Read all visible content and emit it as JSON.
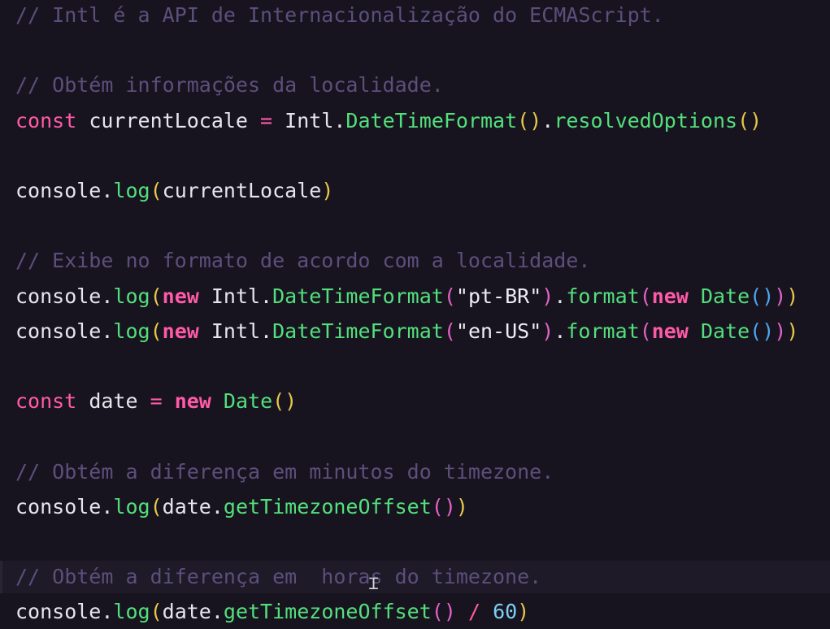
{
  "editor": {
    "cursor_icon": "text-cursor-icon",
    "colors": {
      "background": "#18141f",
      "comment": "#5b4f7c",
      "keyword": "#ff5aa8",
      "function": "#52e07c",
      "text": "#e7e5ec",
      "string": "#f0ecf4",
      "number": "#7ecff5",
      "paren_yellow": "#e6c94a",
      "paren_pink": "#e063c6",
      "paren_blue": "#4aa7f0",
      "operator": "#ff5aa8"
    },
    "lines": [
      {
        "tokens": [
          {
            "t": "// Intl é a API de Internacionalização do ECMAScript.",
            "k": "comment"
          }
        ]
      },
      {
        "tokens": []
      },
      {
        "tokens": [
          {
            "t": "// Obtém informações da localidade.",
            "k": "comment"
          }
        ]
      },
      {
        "tokens": [
          {
            "t": "const",
            "k": "keyword"
          },
          {
            "t": " currentLocale ",
            "k": "text"
          },
          {
            "t": "=",
            "k": "operator"
          },
          {
            "t": " Intl.",
            "k": "text"
          },
          {
            "t": "DateTimeFormat",
            "k": "function"
          },
          {
            "t": "()",
            "k": "paren_yellow"
          },
          {
            "t": ".",
            "k": "text"
          },
          {
            "t": "resolvedOptions",
            "k": "function"
          },
          {
            "t": "()",
            "k": "paren_yellow"
          }
        ]
      },
      {
        "tokens": []
      },
      {
        "tokens": [
          {
            "t": "console.",
            "k": "text"
          },
          {
            "t": "log",
            "k": "function"
          },
          {
            "t": "(",
            "k": "paren_yellow"
          },
          {
            "t": "currentLocale",
            "k": "text"
          },
          {
            "t": ")",
            "k": "paren_yellow"
          }
        ]
      },
      {
        "tokens": []
      },
      {
        "tokens": [
          {
            "t": "// Exibe no formato de acordo com a localidade.",
            "k": "comment"
          }
        ]
      },
      {
        "tokens": [
          {
            "t": "console.",
            "k": "text"
          },
          {
            "t": "log",
            "k": "function"
          },
          {
            "t": "(",
            "k": "paren_yellow"
          },
          {
            "t": "new",
            "k": "keyword_bold"
          },
          {
            "t": " Intl.",
            "k": "text"
          },
          {
            "t": "DateTimeFormat",
            "k": "function"
          },
          {
            "t": "(",
            "k": "paren_pink"
          },
          {
            "t": "\"pt-BR\"",
            "k": "string"
          },
          {
            "t": ")",
            "k": "paren_pink"
          },
          {
            "t": ".",
            "k": "text"
          },
          {
            "t": "format",
            "k": "function"
          },
          {
            "t": "(",
            "k": "paren_pink"
          },
          {
            "t": "new",
            "k": "keyword_bold"
          },
          {
            "t": " Date",
            "k": "function"
          },
          {
            "t": "()",
            "k": "paren_blue"
          },
          {
            "t": ")",
            "k": "paren_pink"
          },
          {
            "t": ")",
            "k": "paren_yellow"
          }
        ]
      },
      {
        "tokens": [
          {
            "t": "console.",
            "k": "text"
          },
          {
            "t": "log",
            "k": "function"
          },
          {
            "t": "(",
            "k": "paren_yellow"
          },
          {
            "t": "new",
            "k": "keyword_bold"
          },
          {
            "t": " Intl.",
            "k": "text"
          },
          {
            "t": "DateTimeFormat",
            "k": "function"
          },
          {
            "t": "(",
            "k": "paren_pink"
          },
          {
            "t": "\"en-US\"",
            "k": "string"
          },
          {
            "t": ")",
            "k": "paren_pink"
          },
          {
            "t": ".",
            "k": "text"
          },
          {
            "t": "format",
            "k": "function"
          },
          {
            "t": "(",
            "k": "paren_pink"
          },
          {
            "t": "new",
            "k": "keyword_bold"
          },
          {
            "t": " Date",
            "k": "function"
          },
          {
            "t": "()",
            "k": "paren_blue"
          },
          {
            "t": ")",
            "k": "paren_pink"
          },
          {
            "t": ")",
            "k": "paren_yellow"
          }
        ]
      },
      {
        "tokens": []
      },
      {
        "tokens": [
          {
            "t": "const",
            "k": "keyword"
          },
          {
            "t": " date ",
            "k": "text"
          },
          {
            "t": "=",
            "k": "operator"
          },
          {
            "t": " ",
            "k": "text"
          },
          {
            "t": "new",
            "k": "keyword_bold"
          },
          {
            "t": " Date",
            "k": "function"
          },
          {
            "t": "()",
            "k": "paren_yellow"
          }
        ]
      },
      {
        "tokens": []
      },
      {
        "tokens": [
          {
            "t": "// Obtém a diferença em minutos do timezone.",
            "k": "comment"
          }
        ]
      },
      {
        "tokens": [
          {
            "t": "console.",
            "k": "text"
          },
          {
            "t": "log",
            "k": "function"
          },
          {
            "t": "(",
            "k": "paren_yellow"
          },
          {
            "t": "date.",
            "k": "text"
          },
          {
            "t": "getTimezoneOffset",
            "k": "function"
          },
          {
            "t": "()",
            "k": "paren_pink"
          },
          {
            "t": ")",
            "k": "paren_yellow"
          }
        ]
      },
      {
        "tokens": []
      },
      {
        "tokens": [
          {
            "t": "// Obtém a diferença em  horas do timezone.",
            "k": "comment"
          }
        ]
      },
      {
        "tokens": [
          {
            "t": "console.",
            "k": "text"
          },
          {
            "t": "log",
            "k": "function"
          },
          {
            "t": "(",
            "k": "paren_yellow"
          },
          {
            "t": "date.",
            "k": "text"
          },
          {
            "t": "getTimezoneOffset",
            "k": "function"
          },
          {
            "t": "()",
            "k": "paren_pink"
          },
          {
            "t": " ",
            "k": "text"
          },
          {
            "t": "/",
            "k": "operator"
          },
          {
            "t": " ",
            "k": "text"
          },
          {
            "t": "60",
            "k": "number"
          },
          {
            "t": ")",
            "k": "paren_yellow"
          }
        ]
      }
    ]
  }
}
